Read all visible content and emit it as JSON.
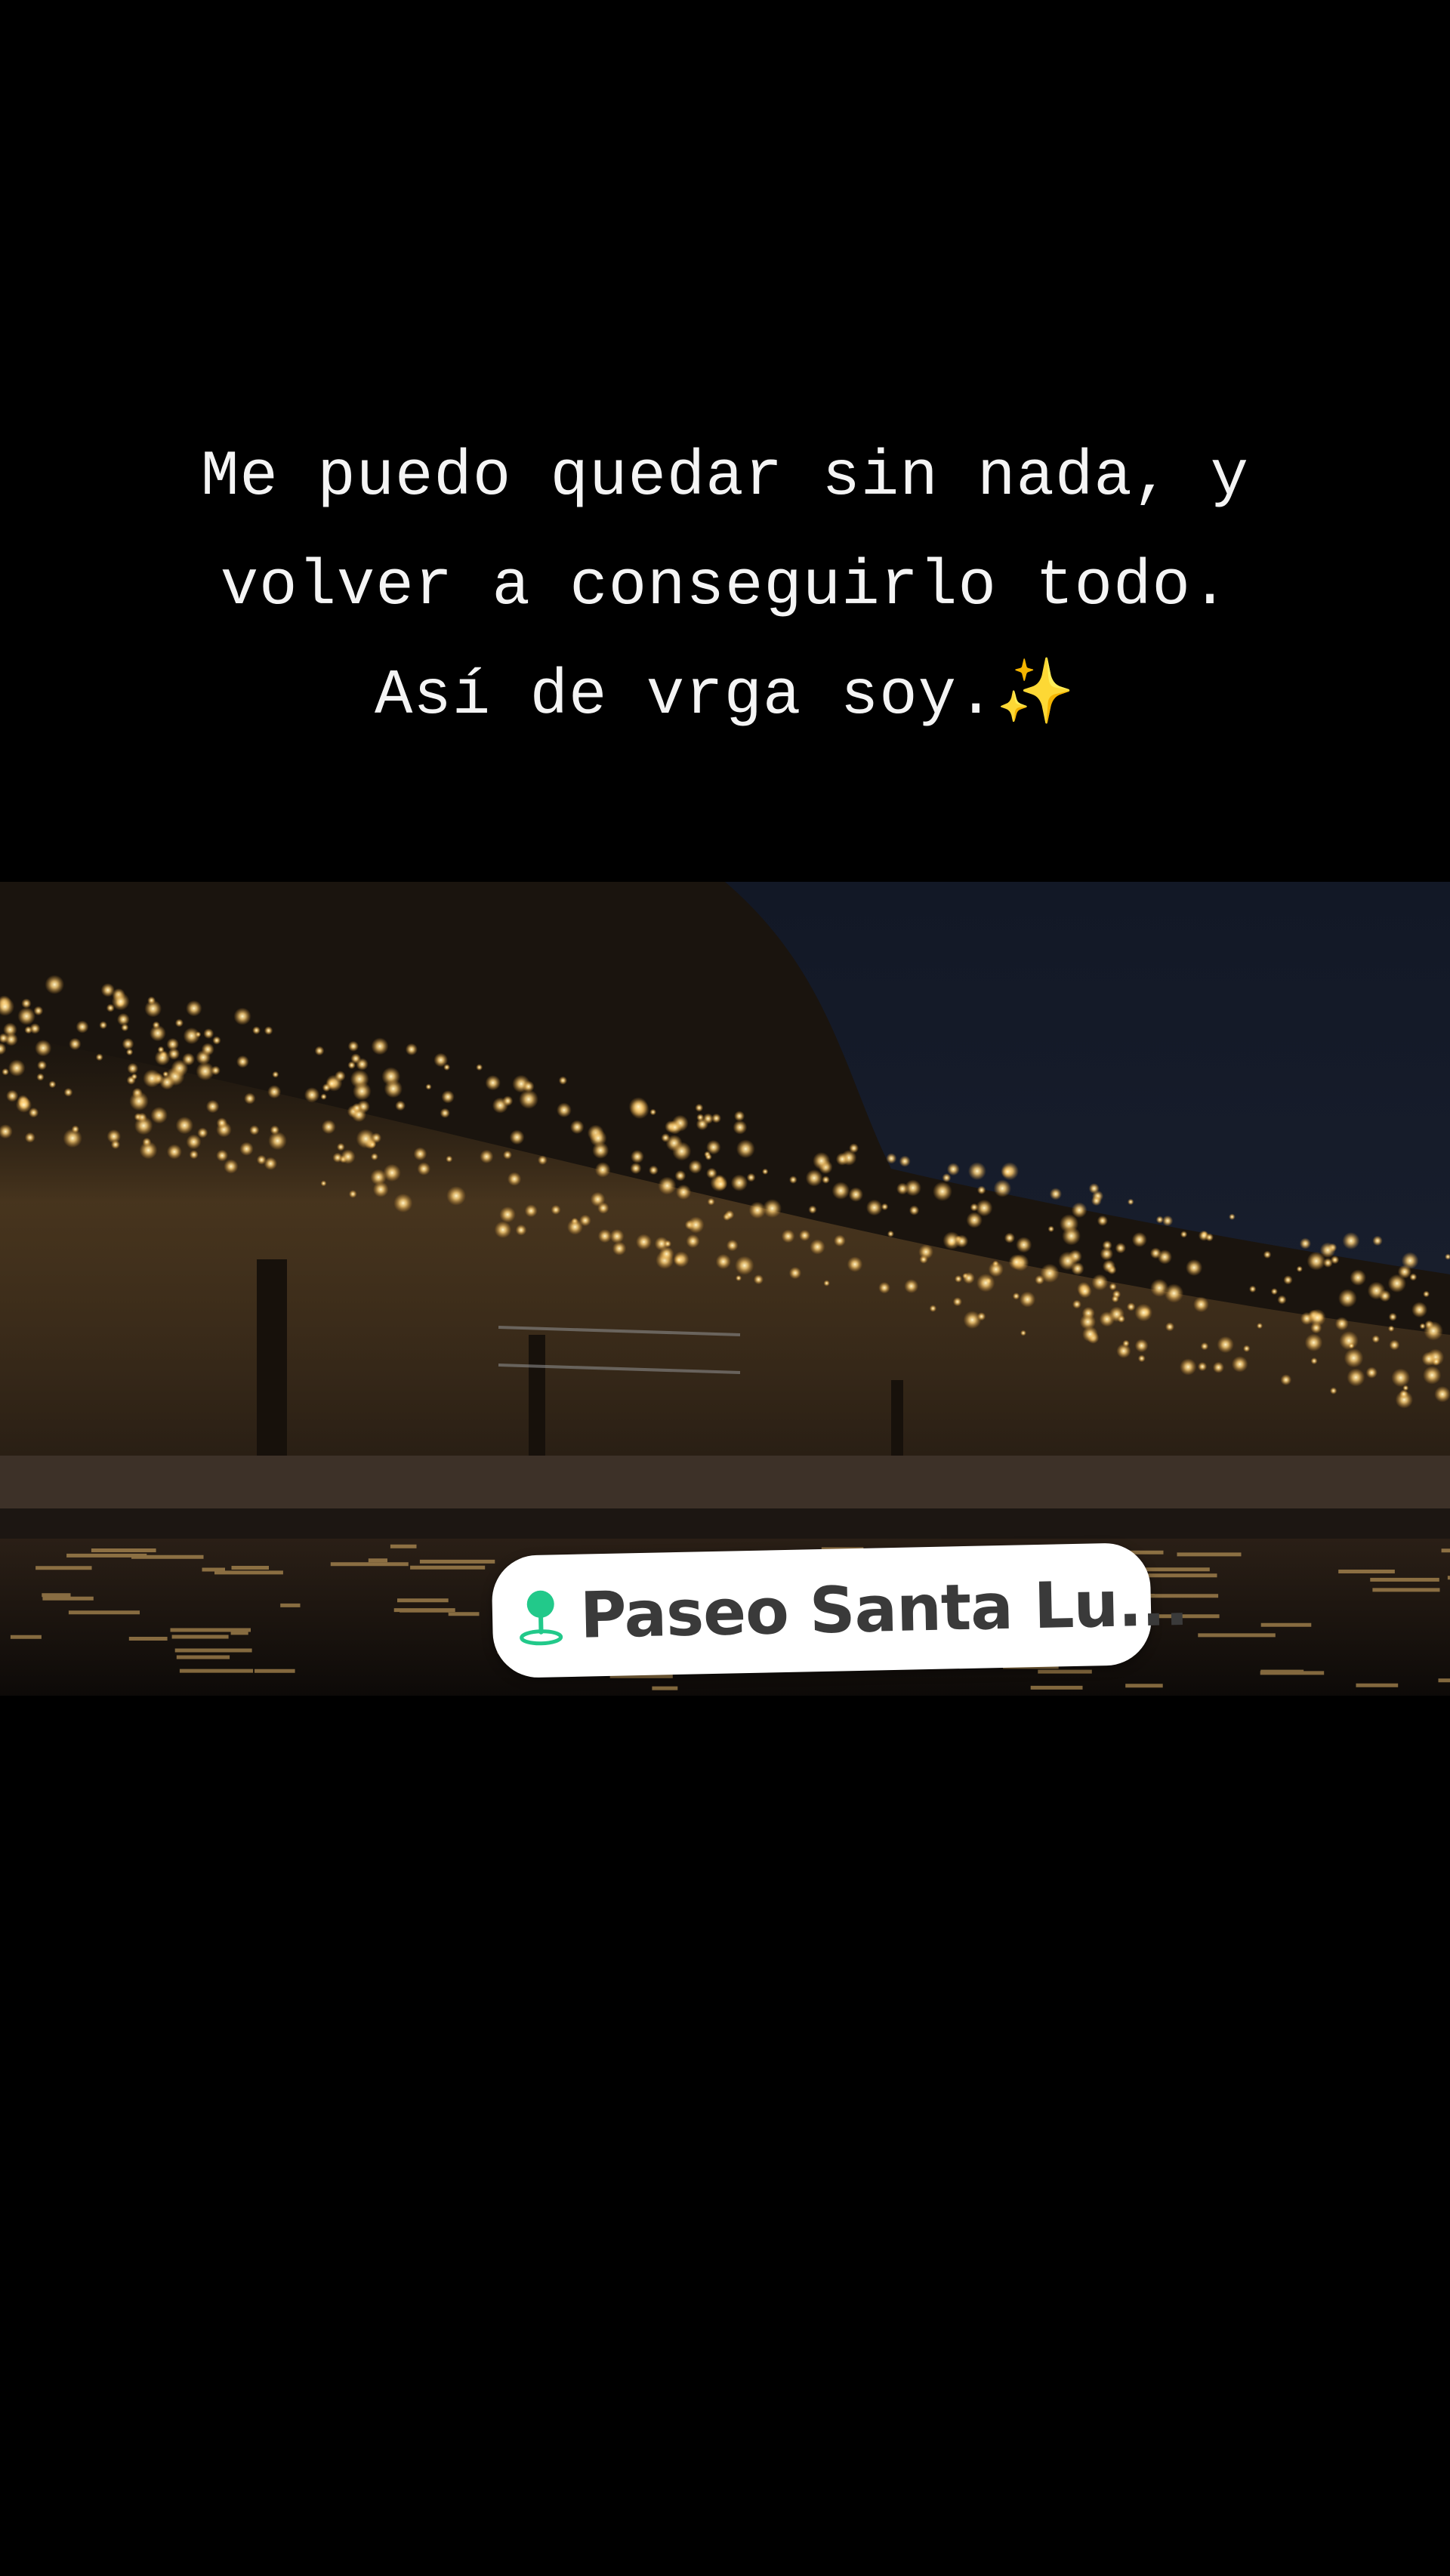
{
  "caption": {
    "line1": "Me puedo quedar sin nada, y",
    "line2": "volver a conseguirlo todo.",
    "line3": "Así de vrga soy.",
    "sparkle": "✨"
  },
  "location_sticker": {
    "icon": "location-pin-icon",
    "label": "Paseo Santa Lu...",
    "icon_color": "#22c98a"
  }
}
